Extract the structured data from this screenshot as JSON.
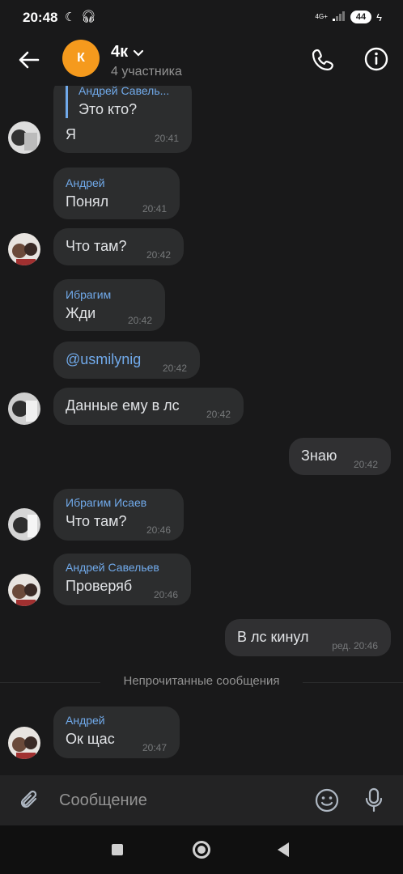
{
  "status_bar": {
    "time": "20:48",
    "network": "4G+",
    "battery": "44"
  },
  "header": {
    "avatar_letter": "К",
    "title": "4к",
    "subtitle": "4 участника",
    "icons": [
      "back-arrow-icon",
      "chevron-down-icon",
      "phone-icon",
      "info-icon"
    ],
    "accent": "#f59a1d"
  },
  "messages": [
    {
      "sender": "Андрей Савель...",
      "text": "Это кто?",
      "text2": "Я",
      "time": "20:41",
      "incoming": true,
      "is_reply": true
    },
    {
      "sender": "Андрей",
      "text": "Понял",
      "time": "20:41",
      "incoming": true
    },
    {
      "sender": "",
      "text": "Что там?",
      "time": "20:42",
      "incoming": true
    },
    {
      "sender": "Ибрагим",
      "text": "Жди",
      "time": "20:42",
      "incoming": true
    },
    {
      "sender": "",
      "text": "@usmilynig",
      "time": "20:42",
      "incoming": true,
      "mention": true
    },
    {
      "sender": "",
      "text": "Данные ему в лс",
      "time": "20:42",
      "incoming": true
    },
    {
      "sender": "",
      "text": "Знаю",
      "time": "20:42",
      "incoming": false
    },
    {
      "sender": "Ибрагим Исаев",
      "text": "Что там?",
      "time": "20:46",
      "incoming": true
    },
    {
      "sender": "Андрей Савельев",
      "text": "Проверяб",
      "time": "20:46",
      "incoming": true
    },
    {
      "sender": "",
      "text": "В лс кинул",
      "time": "ред. 20:46",
      "incoming": false
    },
    {
      "sender": "Андрей",
      "text": "Ок щас",
      "time": "20:47",
      "incoming": true
    }
  ],
  "unread_divider": "Непрочитанные сообщения",
  "composer": {
    "placeholder": "Сообщение"
  },
  "colors": {
    "background": "#19191a",
    "bubble": "#2c2d2e",
    "link": "#71aaeb"
  }
}
